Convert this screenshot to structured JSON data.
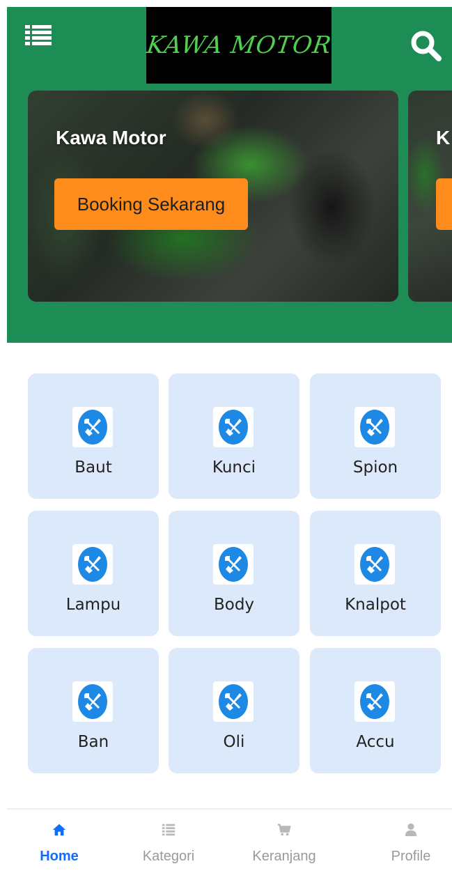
{
  "header": {
    "logo_text": "KAWA MOTOR",
    "bg_color": "#1e8c55",
    "menu_icon": "list-icon",
    "search_icon": "search-icon"
  },
  "banner": {
    "slides": [
      {
        "title": "Kawa Motor",
        "button_label": "Booking Sekarang"
      },
      {
        "title": "K",
        "button_label": ""
      }
    ],
    "button_color": "#fd8c1c"
  },
  "categories": [
    {
      "label": "Baut",
      "icon": "wrench-icon"
    },
    {
      "label": "Kunci",
      "icon": "wrench-icon"
    },
    {
      "label": "Spion",
      "icon": "wrench-icon"
    },
    {
      "label": "Lampu",
      "icon": "wrench-icon"
    },
    {
      "label": "Body",
      "icon": "wrench-icon"
    },
    {
      "label": "Knalpot",
      "icon": "wrench-icon"
    },
    {
      "label": "Ban",
      "icon": "wrench-icon"
    },
    {
      "label": "Oli",
      "icon": "wrench-icon"
    },
    {
      "label": "Accu",
      "icon": "wrench-icon"
    }
  ],
  "bottom_nav": {
    "items": [
      {
        "label": "Home",
        "icon": "home-icon",
        "active": true
      },
      {
        "label": "Kategori",
        "icon": "list-icon",
        "active": false
      },
      {
        "label": "Keranjang",
        "icon": "cart-icon",
        "active": false
      },
      {
        "label": "Profile",
        "icon": "user-icon",
        "active": false
      }
    ],
    "active_color": "#0d6efd",
    "inactive_color": "#9a9a9a"
  }
}
